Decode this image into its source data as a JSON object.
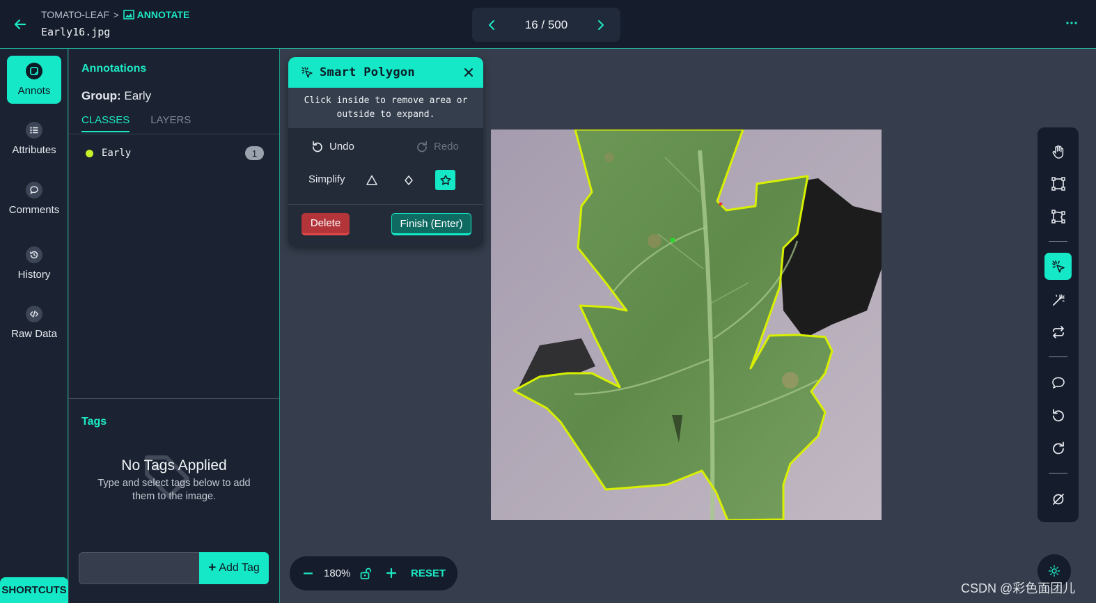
{
  "header": {
    "breadcrumb_project": "TOMATO-LEAF",
    "breadcrumb_separator": ">",
    "breadcrumb_current": "ANNOTATE",
    "filename": "Early16.jpg",
    "pager": "16 / 500"
  },
  "rail": {
    "items": [
      {
        "label": "Annots",
        "icon": "annotation-icon",
        "active": true
      },
      {
        "label": "Attributes",
        "icon": "list-icon"
      },
      {
        "label": "Comments",
        "icon": "comment-icon"
      },
      {
        "label": "History",
        "icon": "history-icon"
      },
      {
        "label": "Raw Data",
        "icon": "code-icon"
      }
    ],
    "shortcuts": "SHORTCUTS"
  },
  "panel": {
    "title": "Annotations",
    "group_label": "Group:",
    "group_value": "Early",
    "tabs": [
      {
        "label": "CLASSES",
        "active": true
      },
      {
        "label": "LAYERS"
      }
    ],
    "classes": [
      {
        "name": "Early",
        "count": "1",
        "color": "#c6f22a"
      }
    ],
    "tags_title": "Tags",
    "no_tags": "No Tags Applied",
    "no_tags_sub": "Type and select tags below to add them to the image.",
    "tag_input_placeholder": "",
    "add_tag": "Add Tag"
  },
  "smart_polygon": {
    "title": "Smart Polygon",
    "hint": "Click inside to remove area or outside to expand.",
    "undo": "Undo",
    "redo": "Redo",
    "simplify": "Simplify",
    "simplify_options": [
      "triangle-icon",
      "diamond-icon",
      "star-icon"
    ],
    "simplify_selected": "star-icon",
    "delete": "Delete",
    "finish": "Finish (Enter)"
  },
  "toolbar": {
    "tools": [
      "hand-icon",
      "bounding-box-icon",
      "polygon-icon",
      "smart-polygon-icon",
      "magic-wand-icon",
      "repeat-icon",
      "comment-icon",
      "undo-icon",
      "redo-icon",
      "null-icon"
    ],
    "active": "smart-polygon-icon"
  },
  "zoom": {
    "level": "180%",
    "reset": "RESET"
  },
  "watermark": "CSDN @彩色面团儿",
  "colors": {
    "accent": "#14e8c7",
    "annotation_outline": "#d8f000",
    "delete": "#b3353a"
  }
}
